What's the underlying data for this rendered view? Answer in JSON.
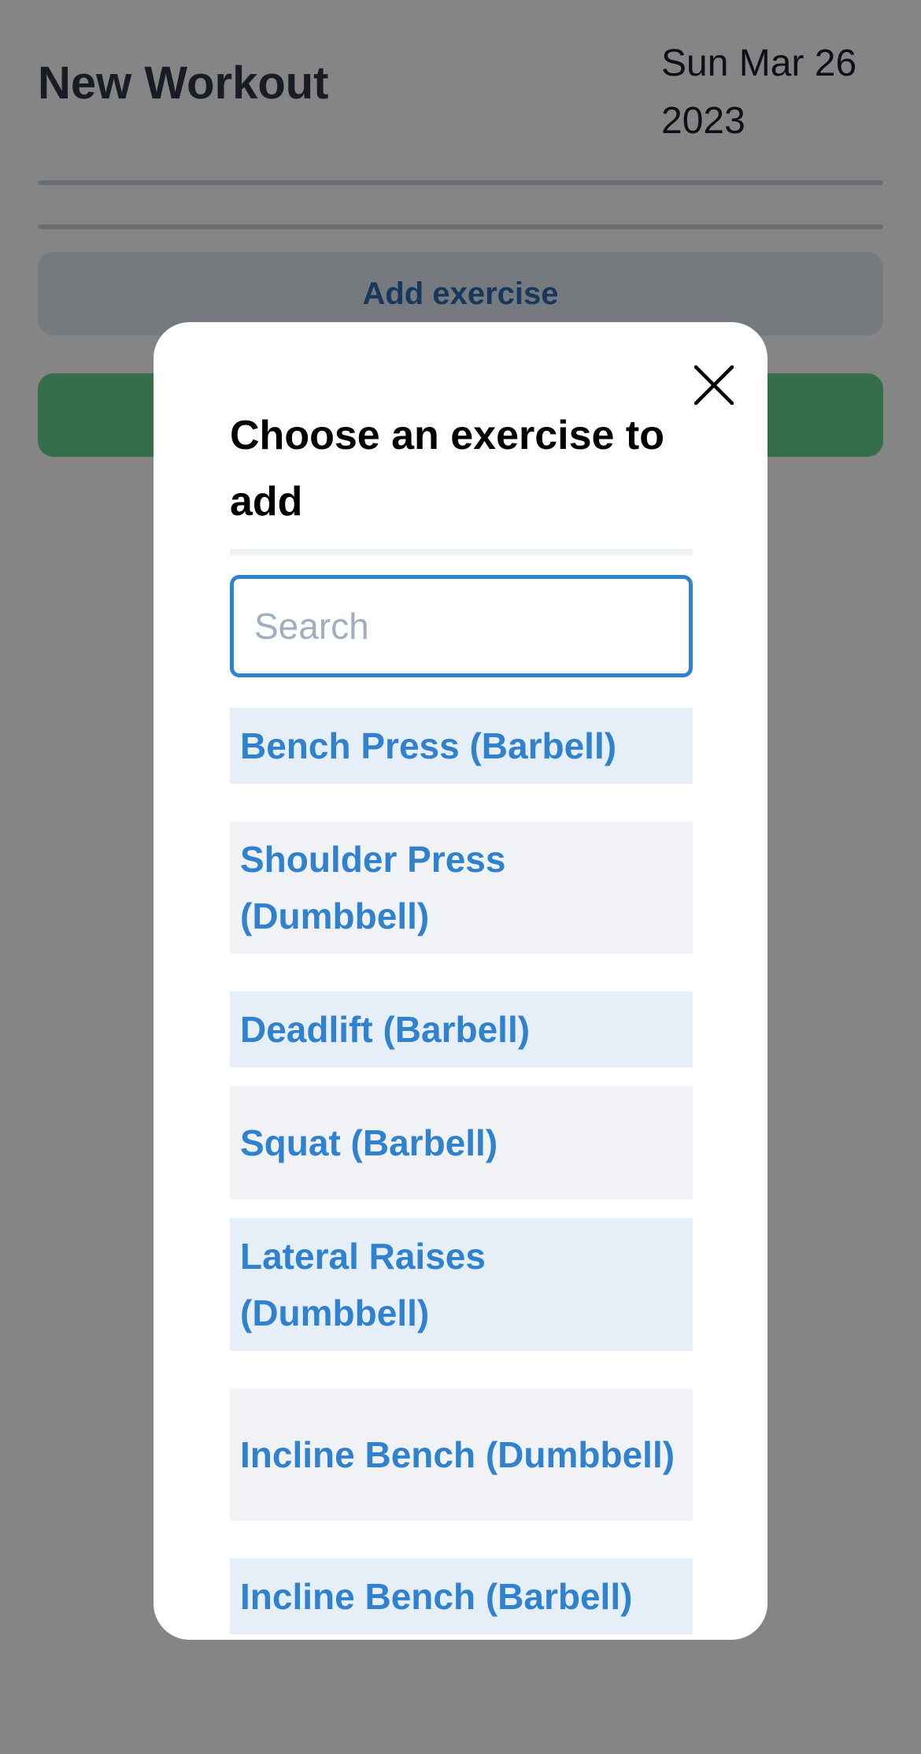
{
  "page": {
    "title": "New Workout",
    "date": "Sun Mar 26 2023",
    "add_exercise_label": "Add exercise"
  },
  "modal": {
    "title": "Choose an exercise to add",
    "close_icon": "close-icon",
    "search": {
      "placeholder": "Search",
      "value": ""
    },
    "exercises": [
      {
        "label": "Bench Press (Barbell)"
      },
      {
        "label": "Shoulder Press (Dumbbell)"
      },
      {
        "label": "Deadlift (Barbell)"
      },
      {
        "label": "Squat (Barbell)"
      },
      {
        "label": "Lateral Raises (Dumbbell)"
      },
      {
        "label": "Incline Bench (Dumbbell)"
      },
      {
        "label": "Incline Bench (Barbell)"
      }
    ]
  },
  "colors": {
    "accent_blue": "#3182ce",
    "green_button": "#68d391",
    "overlay": "#000000"
  }
}
